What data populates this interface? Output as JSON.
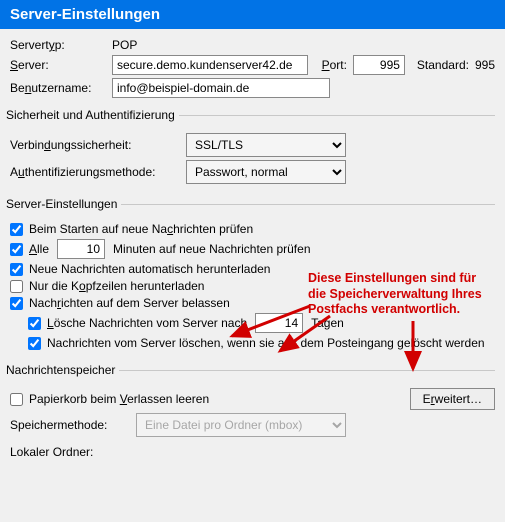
{
  "title": "Server-Einstellungen",
  "servertype_label_pre": "Servert",
  "servertype_label_u": "y",
  "servertype_label_post": "p:",
  "servertype_value": "POP",
  "server_label_u": "S",
  "server_label_post": "erver:",
  "server_value": "secure.demo.kundenserver42.de",
  "port_label_u": "P",
  "port_label_post": "ort:",
  "port_value": "995",
  "standard_label": "Standard:",
  "standard_value": "995",
  "user_label_pre": "Be",
  "user_label_u": "n",
  "user_label_post": "utzername:",
  "user_value": "info@beispiel-domain.de",
  "sec_legend": "Sicherheit und Authentifizierung",
  "connsec_pre": "Verbin",
  "connsec_u": "d",
  "connsec_post": "ungssicherheit:",
  "connsec_value": "SSL/TLS",
  "auth_pre": "A",
  "auth_u": "u",
  "auth_post": "thentifizierungsmethode:",
  "auth_value": "Passwort, normal",
  "srv_legend": "Server-Einstellungen",
  "cb_start_pre": "Beim Starten auf neue Na",
  "cb_start_u": "c",
  "cb_start_post": "hrichten prüfen",
  "cb_alle_u": "A",
  "cb_alle_post": "lle",
  "cb_alle_value": "10",
  "cb_alle_suffix": "Minuten auf neue Nachrichten prüfen",
  "cb_auto": "Neue Nachrichten automatisch herunterladen",
  "cb_header_pre": "Nur die K",
  "cb_header_u": "o",
  "cb_header_post": "pfzeilen herunterladen",
  "cb_leave_pre": "Nach",
  "cb_leave_u": "r",
  "cb_leave_post": "ichten auf dem Server belassen",
  "cb_del_after_pre": "",
  "cb_del_after_u": "L",
  "cb_del_after_post": "ösche Nachrichten vom Server nach",
  "cb_del_after_value": "14",
  "cb_del_after_suffix": "Tagen",
  "cb_del_inbox": "Nachrichten vom Server löschen, wenn sie aus dem Posteingang gelöscht werden",
  "annotation_l1": "Diese Einstellungen sind für",
  "annotation_l2": "die Speicherverwaltung Ihres",
  "annotation_l3": "Postfachs verantwortlich.",
  "msgstore_legend": "Nachrichtenspeicher",
  "cb_trash_pre": "Papierkorb beim ",
  "cb_trash_u": "V",
  "cb_trash_post": "erlassen leeren",
  "advanced_pre": "E",
  "advanced_u": "r",
  "advanced_post": "weitert…",
  "storage_label": "Speichermethode:",
  "storage_value": "Eine Datei pro Ordner (mbox)",
  "localfolder_label": "Lokaler Ordner:"
}
